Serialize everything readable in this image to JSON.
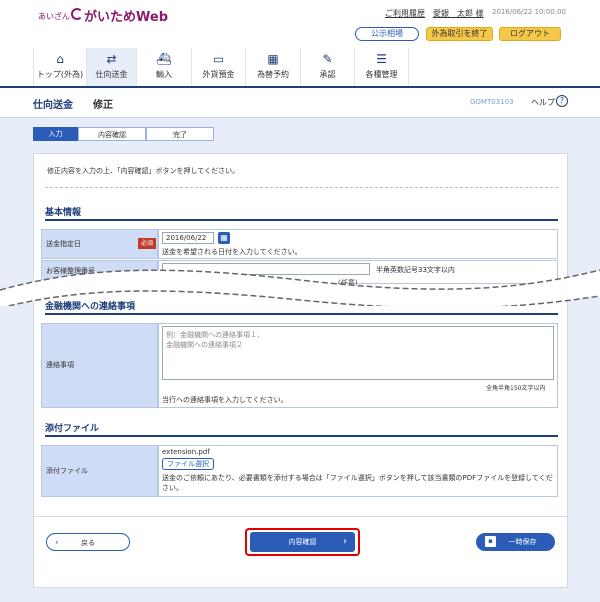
{
  "header": {
    "logo_small": "あいざん",
    "logo_main": "がいためWeb",
    "usage_history": "ご利用履歴",
    "user_name": "愛銀　太郎 様",
    "datetime": "2016/06/22 10:00:00",
    "public_rates": "公示相場",
    "end_fx": "外為取引を終了",
    "logout": "ログアウト"
  },
  "nav": [
    {
      "label": "トップ(外為)",
      "icon": "home-icon",
      "glyph": "⌂"
    },
    {
      "label": "仕向送金",
      "icon": "remittance-icon",
      "glyph": "⇄"
    },
    {
      "label": "輸入",
      "icon": "ship-icon",
      "glyph": "⛴"
    },
    {
      "label": "外貨預金",
      "icon": "deposit-icon",
      "glyph": "▭"
    },
    {
      "label": "為替予約",
      "icon": "chart-icon",
      "glyph": "▦"
    },
    {
      "label": "承認",
      "icon": "approve-icon",
      "glyph": "✎"
    },
    {
      "label": "各種管理",
      "icon": "manage-icon",
      "glyph": "☰"
    }
  ],
  "page": {
    "title": "仕向送金",
    "subtitle": "修正",
    "screen_id": "GOMT03103",
    "help": "ヘルプ"
  },
  "steps": [
    "入力",
    "内容確認",
    "完了"
  ],
  "instruction": "修正内容を入力の上、「内容確認」ボタンを押してください。",
  "basic": {
    "heading": "基本情報",
    "date_label": "送金指定日",
    "required": "必須",
    "date_value": "2016/06/22",
    "date_hint": "送金を希望される日付を入力してください。",
    "ref_label": "お客様整理番号",
    "ref_hint": "半角英数記号33文字以内",
    "ref_hint2": "(任意)"
  },
  "contact": {
    "heading": "金融機関への連絡事項",
    "label": "連絡事項",
    "placeholder": "例）金融機関への連絡事項１、\n金融機関への連絡事項２",
    "limit": "全角半角150文字以内",
    "hint": "当行への連絡事項を入力してください。"
  },
  "attach": {
    "heading": "添付ファイル",
    "label": "添付ファイル",
    "filename": "extension.pdf",
    "select_button": "ファイル選択",
    "note": "送金のご依頼にあたり、必要書類を添付する場合は「ファイル選択」ボタンを押して該当書類のPDFファイルを登録してください。"
  },
  "buttons": {
    "back": "戻る",
    "confirm": "内容確認",
    "save": "一時保存"
  },
  "colors": {
    "brand": "#8c1a6a",
    "navy": "#1f3e7a",
    "accent": "#2b5db8",
    "highlight": "#e00000"
  }
}
